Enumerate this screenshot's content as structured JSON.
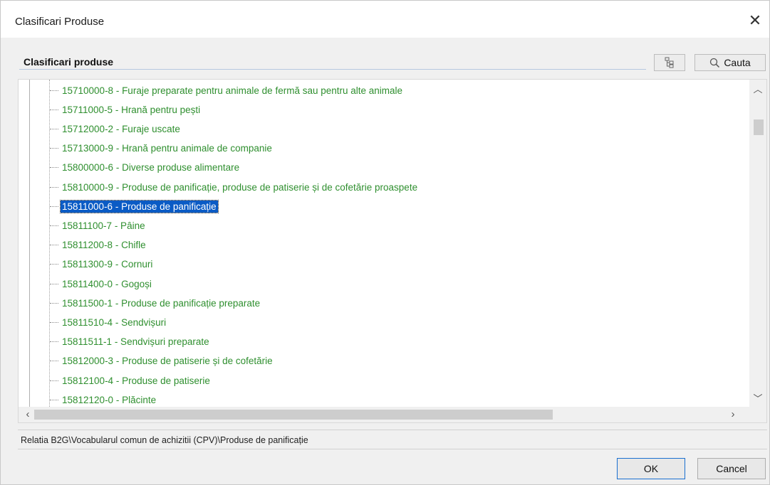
{
  "window": {
    "title": "Clasificari Produse",
    "close_glyph": "✕"
  },
  "header": {
    "section_label": "Clasificari produse",
    "tree_button_icon": "tree-structure-icon",
    "search_button_label": "Cauta",
    "search_icon": "magnifier-icon"
  },
  "tree": {
    "selected_index": 7,
    "items": [
      "15710000-8 - Furaje preparate pentru animale de fermă sau pentru alte animale",
      "15711000-5 - Hrană pentru pești",
      "15712000-2 - Furaje uscate",
      "15713000-9 - Hrană pentru animale de companie",
      "15800000-6 - Diverse produse alimentare",
      "15810000-9 - Produse de panificație, produse de patiserie și de cofetărie proaspete",
      "15811000-6 - Produse de panificație",
      "15811100-7 - Pâine",
      "15811200-8 - Chifle",
      "15811300-9 - Cornuri",
      "15811400-0 - Gogoși",
      "15811500-1 - Produse de panificație preparate",
      "15811510-4 - Sendvișuri",
      "15811511-1 - Sendvișuri preparate",
      "15812000-3 - Produse de patiserie și de cofetărie",
      "15812100-4 - Produse de patiserie",
      "15812120-0 - Plăcinte"
    ]
  },
  "status": {
    "path": "Relatia B2G\\Vocabularul comun de achizitii (CPV)\\Produse de panificație"
  },
  "buttons": {
    "ok": "OK",
    "cancel": "Cancel"
  },
  "colors": {
    "item_text": "#2f8f2f",
    "selection": "#0a5bc5"
  }
}
